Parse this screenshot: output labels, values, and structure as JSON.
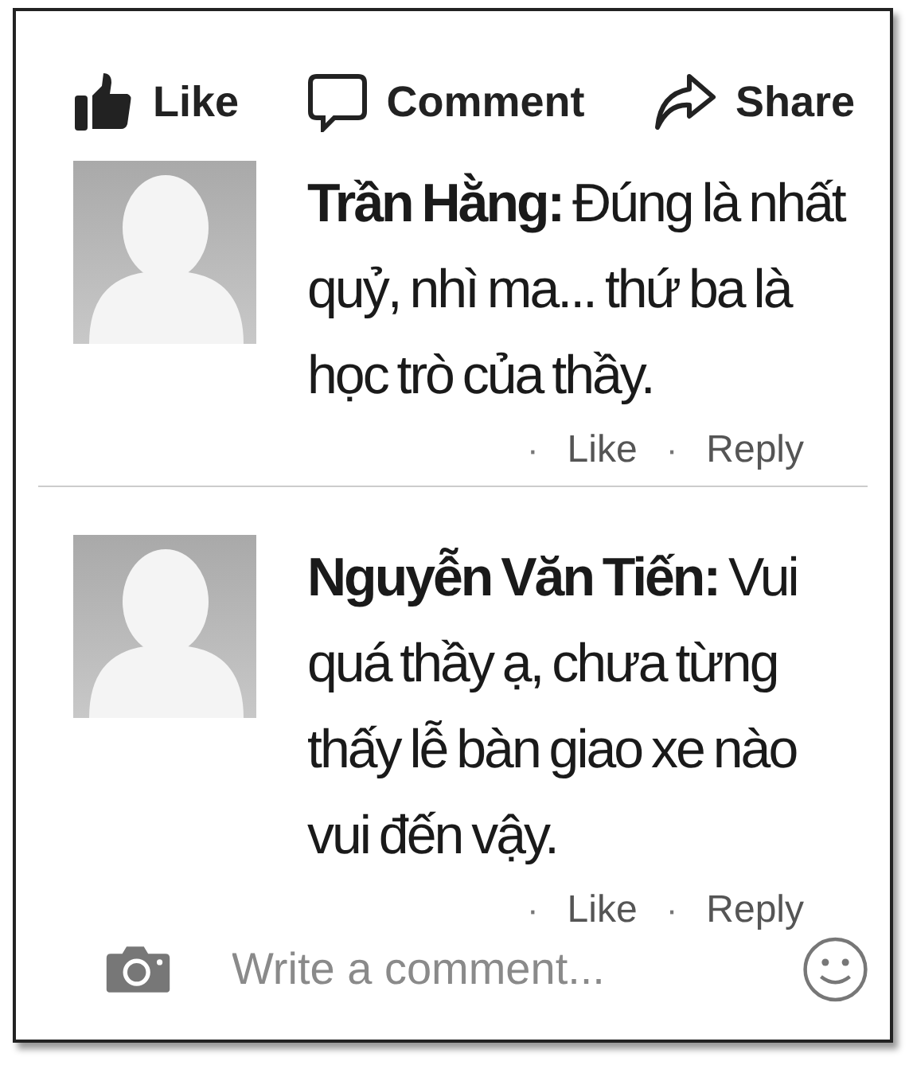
{
  "actions": [
    {
      "kind": "like",
      "label": "Like"
    },
    {
      "kind": "comment",
      "label": "Comment"
    },
    {
      "kind": "share",
      "label": "Share"
    }
  ],
  "comments": [
    {
      "text": "**Trần Hằng:** Đúng là nhất quỷ, nhì ma... thứ ba là học trò của thầy.",
      "separator": "·",
      "like": "Like",
      "reply": "Reply"
    },
    {
      "text": "**Nguyễn Văn Tiến:** Vui quá thầy ạ, chưa từng thấy lễ bàn giao xe nào vui đến vậy.",
      "separator": "·",
      "like": "Like",
      "reply": "Reply"
    }
  ],
  "composer": {
    "placeholder": "Write a comment..."
  }
}
